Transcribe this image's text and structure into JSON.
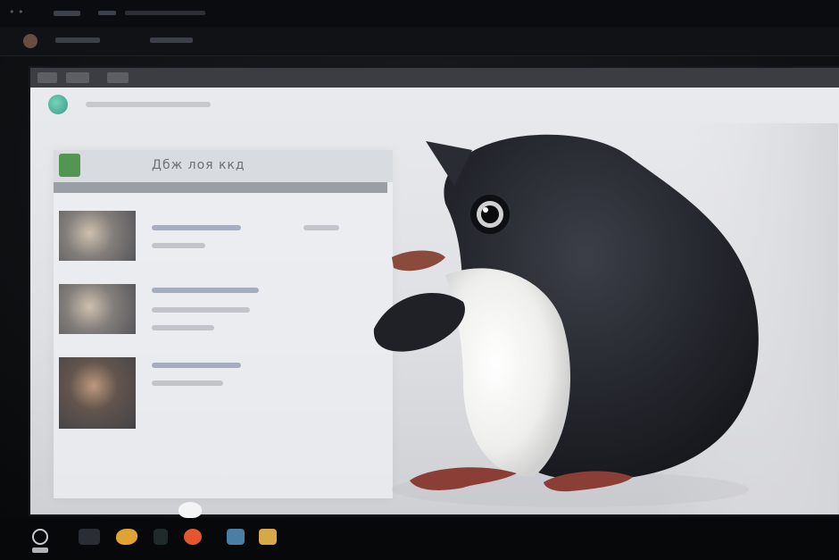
{
  "scene": {
    "description_hidden": "",
    "top_bar": {
      "label_1": "",
      "label_2": "",
      "label_3": ""
    },
    "monitor": {
      "toolbar": {
        "items": [
          "",
          "",
          ""
        ]
      },
      "app": {
        "card_title": "Дбж лоя ккд",
        "rows": 3
      }
    },
    "taskbar": {
      "icons": [
        "power-icon",
        "monitor-icon",
        "fish-icon",
        "app-icon",
        "fire-icon",
        "calc-icon",
        "folder-icon"
      ]
    },
    "colors": {
      "bezel": "#0b0c0e",
      "screen": "#e3e4e8",
      "penguin_body": "#2a2d34",
      "penguin_belly": "#f2f2f0",
      "penguin_feet": "#8a3e35",
      "logo": "#2fae92",
      "badge": "#3c8a3a"
    }
  }
}
